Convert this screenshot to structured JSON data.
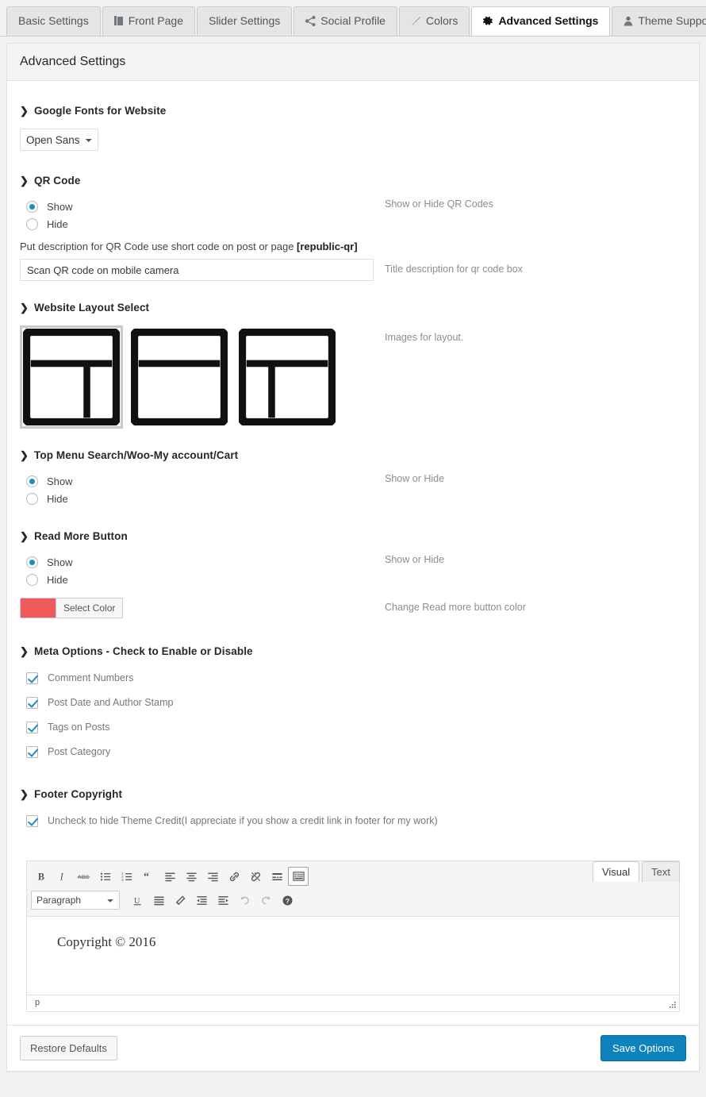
{
  "tabs": [
    {
      "label": "Basic Settings",
      "icon": "",
      "active": false
    },
    {
      "label": "Front Page",
      "icon": "book-icon",
      "active": false
    },
    {
      "label": "Slider Settings",
      "icon": "",
      "active": false
    },
    {
      "label": "Social Profile",
      "icon": "share-icon",
      "active": false
    },
    {
      "label": "Colors",
      "icon": "brush-icon",
      "active": false
    },
    {
      "label": "Advanced Settings",
      "icon": "gear-icon",
      "active": true
    },
    {
      "label": "Theme Support",
      "icon": "user-icon",
      "active": false
    }
  ],
  "panel": {
    "title": "Advanced Settings"
  },
  "sections": {
    "google_fonts": {
      "title": "Google Fonts for Website",
      "select_value": "Open Sans",
      "options": [
        "Open Sans"
      ]
    },
    "qr_code": {
      "title": "QR Code",
      "radio_show": "Show",
      "radio_hide": "Hide",
      "selected": "Show",
      "desc_radio": "Show or Hide QR Codes",
      "note_prefix": "Put description for QR Code use short code on post or page ",
      "note_shortcode": "[republic-qr]",
      "input_value": "Scan QR code on mobile camera",
      "input_placeholder": "Scan QR code on mobile camera",
      "desc_input": "Title description for qr code box"
    },
    "website_layout": {
      "title": "Website Layout Select",
      "desc": "Images for layout.",
      "selected_index": 0,
      "options": [
        {
          "name": "layout-right-sidebar"
        },
        {
          "name": "layout-full-width"
        },
        {
          "name": "layout-left-sidebar"
        }
      ]
    },
    "top_menu": {
      "title": "Top Menu Search/Woo-My account/Cart",
      "radio_show": "Show",
      "radio_hide": "Hide",
      "selected": "Show",
      "desc": "Show or Hide"
    },
    "read_more": {
      "title": "Read More Button",
      "radio_show": "Show",
      "radio_hide": "Hide",
      "selected": "Show",
      "desc": "Show or Hide",
      "color_button_label": "Select Color",
      "color_value": "#F05A5A",
      "desc_color": "Change Read more button color"
    },
    "meta_options": {
      "title": "Meta Options - Check to Enable or Disable",
      "items": [
        {
          "label": "Comment Numbers",
          "checked": true
        },
        {
          "label": "Post Date and Author Stamp",
          "checked": true
        },
        {
          "label": "Tags on Posts",
          "checked": true
        },
        {
          "label": "Post Category",
          "checked": true
        }
      ]
    },
    "footer_copyright": {
      "title": "Footer Copyright",
      "credit_label": "Uncheck to hide Theme Credit(I appreciate if you show a credit link in footer for my work)",
      "credit_checked": true
    }
  },
  "editor": {
    "tab_visual": "Visual",
    "tab_text": "Text",
    "active_tab": "Visual",
    "format_value": "Paragraph",
    "format_options": [
      "Paragraph"
    ],
    "content": "Copyright © 2016",
    "status_path": "p",
    "toolbar_row1": [
      "bold-icon",
      "italic-icon",
      "strikethrough-icon",
      "bulleted-list-icon",
      "numbered-list-icon",
      "blockquote-icon",
      "align-left-icon",
      "align-center-icon",
      "align-right-icon",
      "link-icon",
      "unlink-icon",
      "read-more-icon",
      "toggle-toolbar-icon"
    ],
    "toolbar_row2": [
      "underline-icon",
      "justify-icon",
      "text-color-icon",
      "outdent-icon",
      "indent-icon",
      "undo-icon",
      "redo-icon",
      "help-icon"
    ]
  },
  "footer": {
    "restore_label": "Restore Defaults",
    "save_label": "Save Options"
  },
  "colors": {
    "accent": "#0d82bd",
    "radio_dot": "#1e8cbe",
    "read_more": "#F05A5A"
  }
}
